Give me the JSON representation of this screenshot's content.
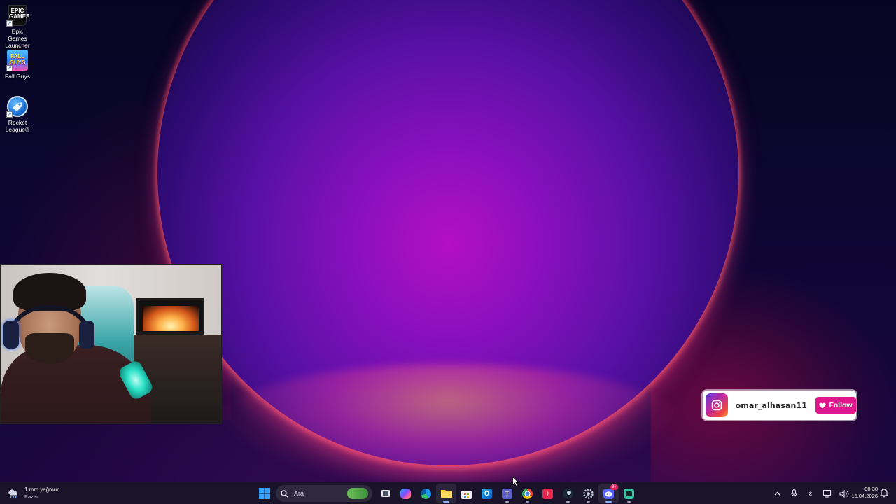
{
  "desktop": {
    "icons": [
      {
        "label": "Epic Games Launcher",
        "logo_text": "EPIC GAMES",
        "icon": "epic-games-icon"
      },
      {
        "label": "Fall Guys",
        "logo_text": "FALL GUYS",
        "icon": "fall-guys-icon"
      },
      {
        "label": "Rocket League®",
        "icon": "rocket-league-icon"
      }
    ]
  },
  "instagram_badge": {
    "username": "omar_alhasan11",
    "follow_label": "Follow",
    "accent_color": "#e2168c",
    "icon": "instagram-icon"
  },
  "taskbar": {
    "weather": {
      "temperature_text": "1 mm yağmur",
      "day": "Pazar",
      "icon": "rain-cloud-icon"
    },
    "search_placeholder": "Ara",
    "pinned_apps": [
      {
        "name": "start",
        "icon": "windows-start-icon"
      },
      {
        "name": "task-view",
        "icon": "task-view-icon"
      },
      {
        "name": "copilot",
        "icon": "copilot-icon"
      },
      {
        "name": "edge",
        "icon": "edge-icon"
      },
      {
        "name": "file-explorer",
        "icon": "folder-icon"
      },
      {
        "name": "microsoft-store",
        "icon": "store-icon"
      },
      {
        "name": "outlook",
        "icon": "outlook-icon"
      },
      {
        "name": "teams",
        "icon": "teams-icon"
      },
      {
        "name": "chrome",
        "icon": "chrome-icon"
      },
      {
        "name": "tiktok",
        "icon": "tiktok-icon"
      },
      {
        "name": "steam",
        "icon": "steam-icon"
      },
      {
        "name": "settings",
        "icon": "settings-gear-icon"
      },
      {
        "name": "discord",
        "icon": "discord-icon",
        "badge": "9+"
      },
      {
        "name": "streamlabs",
        "icon": "streamlabs-icon"
      }
    ],
    "tray": {
      "chevron_icon": "chevron-up-icon",
      "mic_icon": "microphone-icon",
      "language": "ε",
      "network_icon": "network-icon",
      "volume_icon": "volume-icon"
    },
    "clock": {
      "time": "00:30",
      "date": "15.04.2026"
    },
    "notification_icon": "notification-bell-icon"
  }
}
